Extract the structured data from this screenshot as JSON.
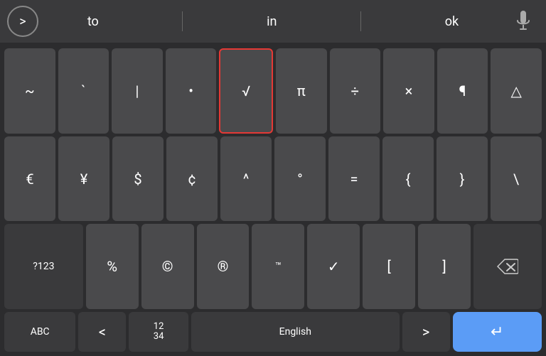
{
  "suggestion_bar": {
    "arrow_label": ">",
    "words": [
      "to",
      "in",
      "ok"
    ]
  },
  "keyboard": {
    "row1": {
      "keys": [
        "~",
        "`",
        "|",
        "•",
        "√",
        "π",
        "÷",
        "×",
        "¶",
        "△"
      ]
    },
    "row2": {
      "keys": [
        "€",
        "¥",
        "$",
        "¢",
        "^",
        "°",
        "=",
        "{",
        "}",
        "\\"
      ]
    },
    "row3": {
      "keys": [
        "?123",
        "%",
        "©",
        "®",
        "™",
        "✓",
        "[",
        "]",
        "⌫"
      ]
    },
    "row4": {
      "abc_label": "ABC",
      "lt_label": "<",
      "numbers_top": "12",
      "numbers_bottom": "34",
      "space_label": "English",
      "gt_label": ">",
      "enter_label": "↵"
    }
  }
}
